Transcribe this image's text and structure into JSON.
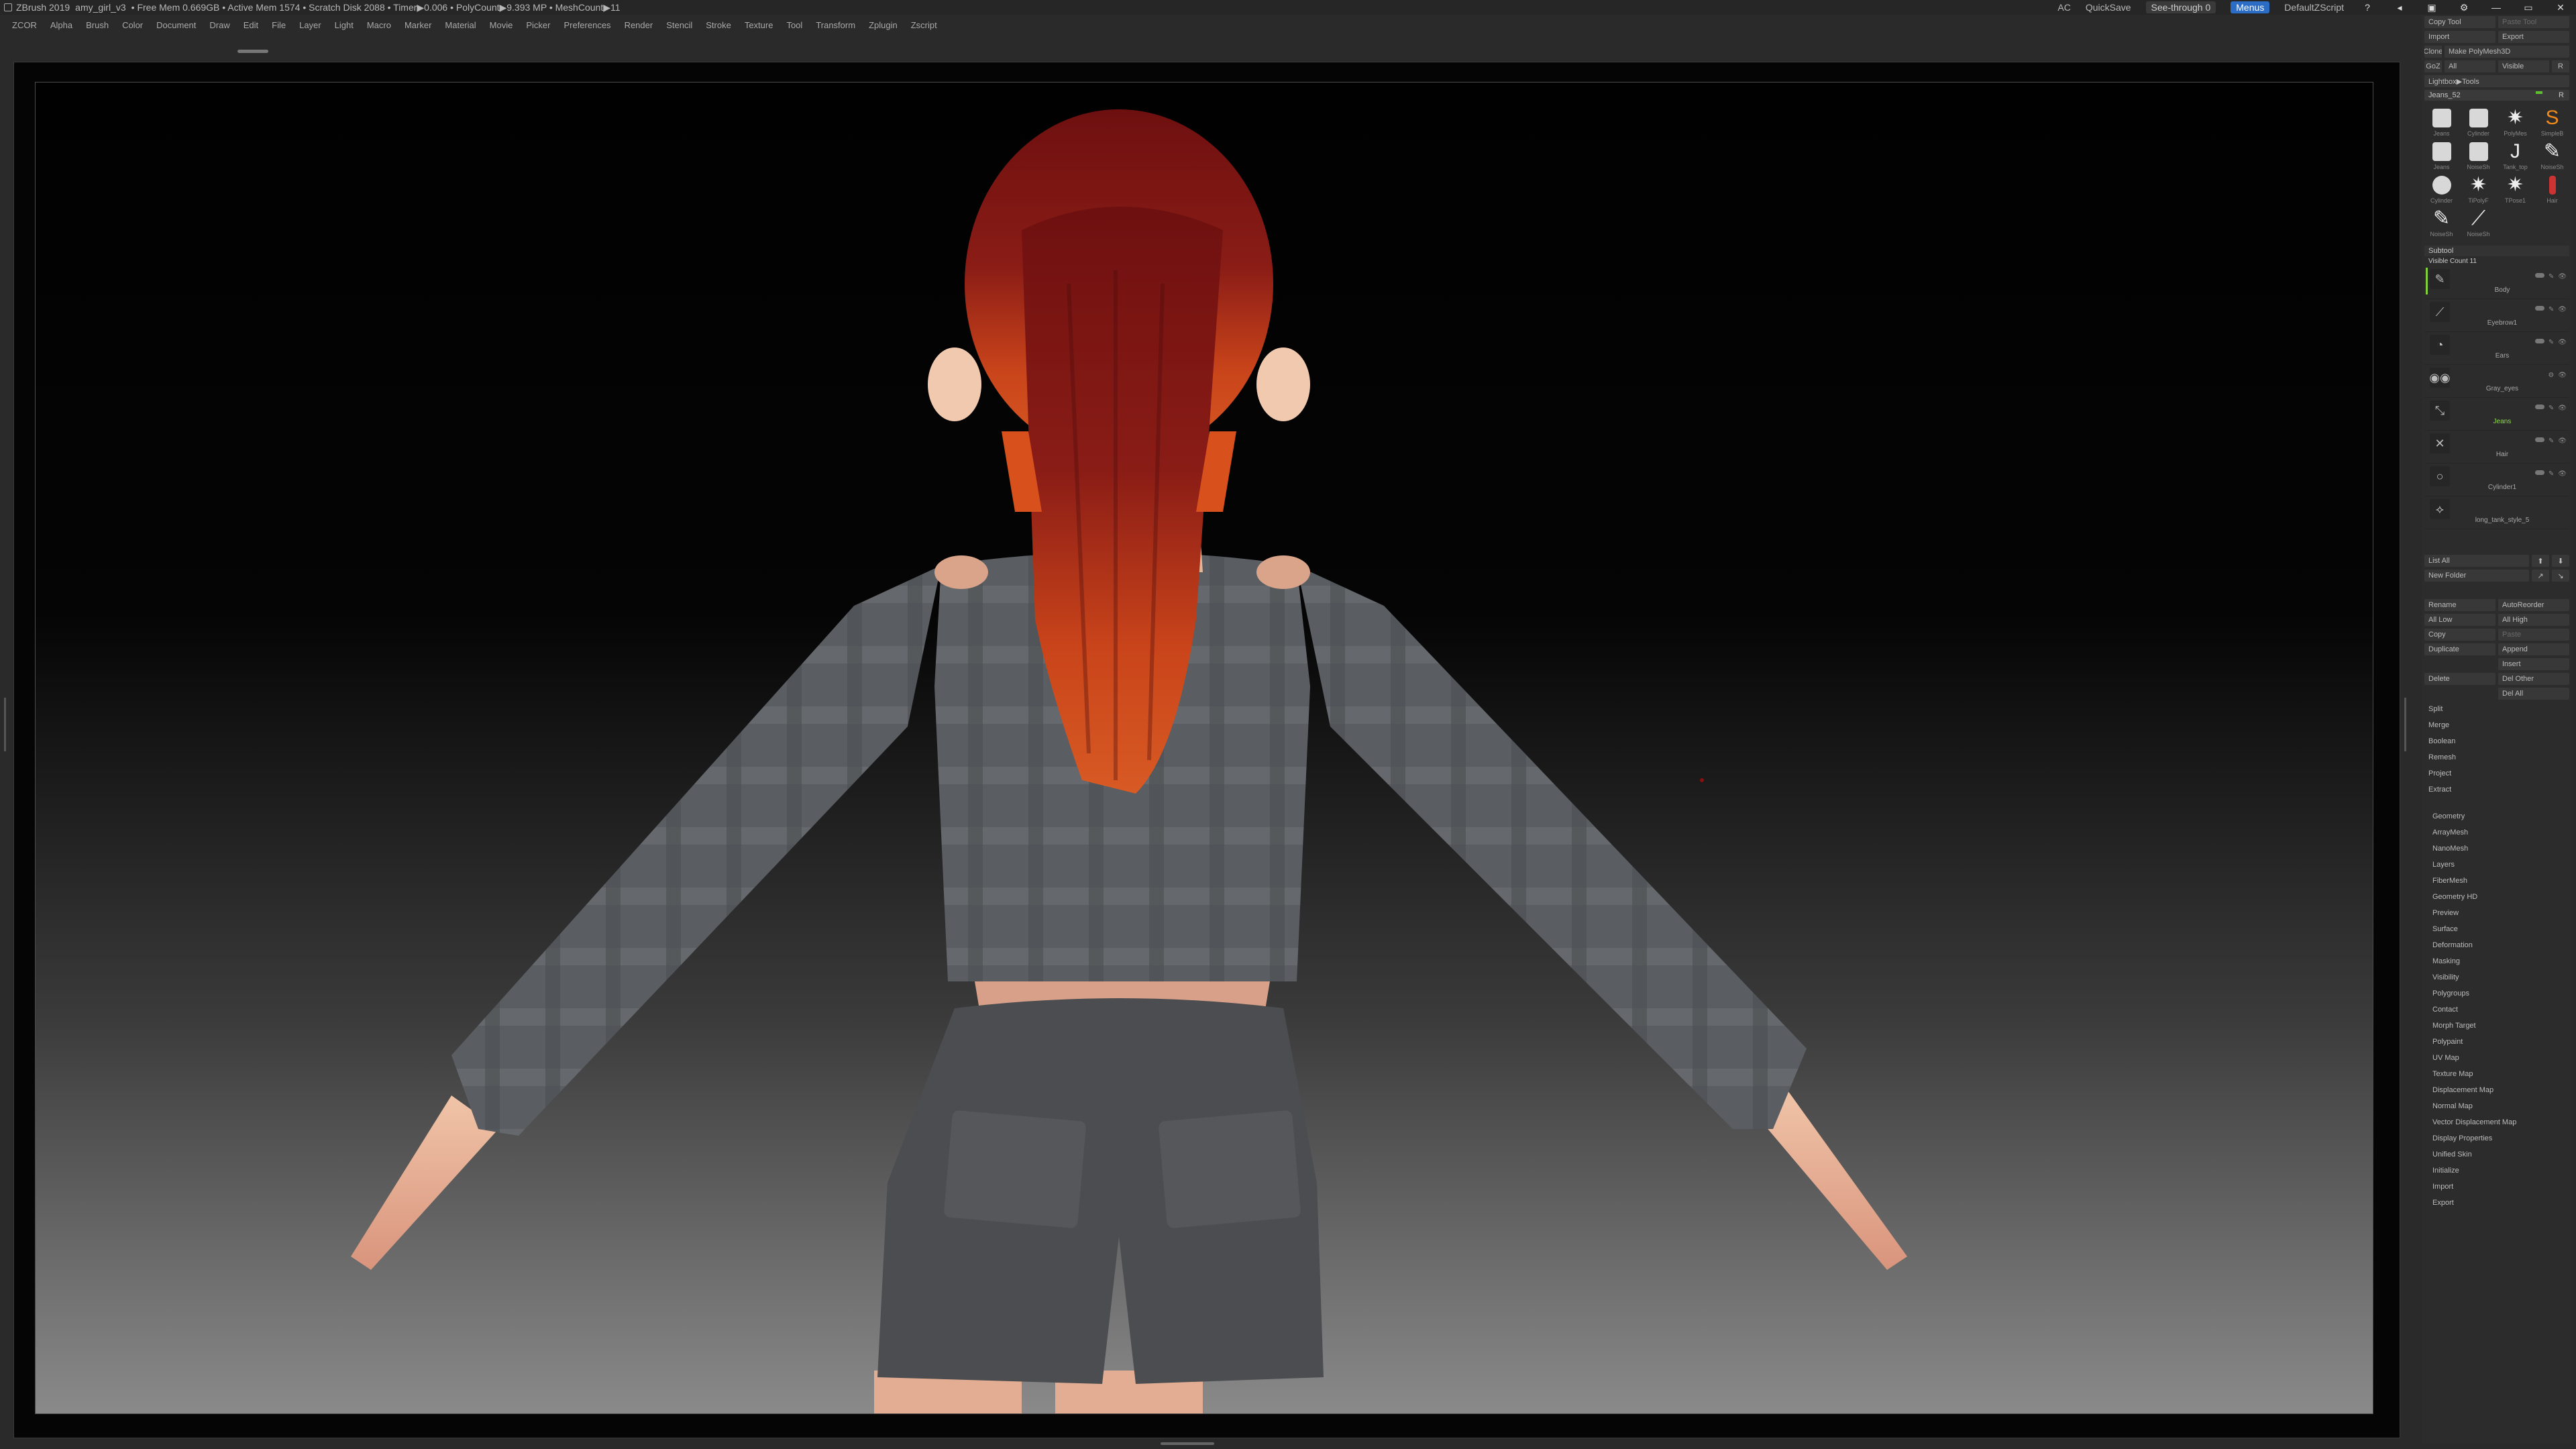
{
  "titlebar": {
    "app": "ZBrush 2019",
    "file": "amy_girl_v3",
    "stats": "• Free Mem 0.669GB • Active Mem 1574 • Scratch Disk 2088 • Timer▶0.006 • PolyCount▶9.393 MP • MeshCount▶11",
    "ac": "AC",
    "quicksave": "QuickSave",
    "seethrough": "See-through  0",
    "menus_label": "Menus",
    "script": "DefaultZScript",
    "win_icons": [
      "?",
      "◂",
      "▣",
      "⚙",
      "—",
      "▭",
      "✕"
    ]
  },
  "menubar": {
    "items": [
      "ZCOR",
      "Alpha",
      "Brush",
      "Color",
      "Document",
      "Draw",
      "Edit",
      "File",
      "Layer",
      "Light",
      "Macro",
      "Marker",
      "Material",
      "Movie",
      "Picker",
      "Preferences",
      "Render",
      "Stencil",
      "Stroke",
      "Texture",
      "Tool",
      "Transform",
      "Zplugin",
      "Zscript"
    ]
  },
  "tool": {
    "copy_tool": "Copy Tool",
    "paste_tool": "Paste Tool",
    "import": "Import",
    "export": "Export",
    "clone": "Clone",
    "make_polymesh": "Make PolyMesh3D",
    "goz": "GoZ",
    "all": "All",
    "visible": "Visible",
    "r": "R",
    "lightbox_tools": "Lightbox▶Tools",
    "current_tool": "Jeans_52",
    "current_value": "R",
    "thumbs": [
      {
        "label": "Jeans",
        "shape": "sq",
        "icon": ""
      },
      {
        "label": "Cylinder",
        "shape": "sq",
        "icon": ""
      },
      {
        "label": "PolyMes",
        "shape": "star",
        "icon": "✷"
      },
      {
        "label": "SimpleB",
        "shape": "orange",
        "icon": "S"
      },
      {
        "label": "Jeans",
        "shape": "sq",
        "icon": ""
      },
      {
        "label": "NoiseSh",
        "shape": "sq",
        "icon": ""
      },
      {
        "label": "Tank_top",
        "shape": "star",
        "icon": "J"
      },
      {
        "label": "NoiseSh",
        "shape": "star",
        "icon": "✎"
      },
      {
        "label": "Cylinder",
        "shape": "",
        "icon": ""
      },
      {
        "label": "TiPolyF",
        "shape": "star",
        "icon": "✷"
      },
      {
        "label": "TPose1",
        "shape": "star",
        "icon": "✷"
      },
      {
        "label": "Hair",
        "shape": "red",
        "icon": ""
      },
      {
        "label": "NoiseSh",
        "shape": "star",
        "icon": "✎"
      },
      {
        "label": "NoiseSh",
        "shape": "star",
        "icon": "⟋"
      }
    ]
  },
  "subtool": {
    "title": "Subtool",
    "visible_count": "Visible Count 11",
    "items": [
      {
        "name": "Body",
        "icon": "✎"
      },
      {
        "name": "Eyebrow1",
        "icon": "⟋"
      },
      {
        "name": "Ears",
        "icon": "◔"
      },
      {
        "name": "Gray_eyes",
        "icon": "◉◉"
      },
      {
        "name": "Jeans",
        "icon": "⤡"
      },
      {
        "name": "Hair",
        "icon": "✕"
      },
      {
        "name": "Cylinder1",
        "icon": "○"
      },
      {
        "name": "long_tank_style_5",
        "icon": "⟡"
      }
    ]
  },
  "subtool_ops": {
    "list_all": "List All",
    "new_folder": "New Folder",
    "rename": "Rename",
    "autoreorder": "AutoReorder",
    "all_low": "All Low",
    "all_high": "All High",
    "copy": "Copy",
    "paste": "Paste",
    "duplicate": "Duplicate",
    "append": "Append",
    "insert": "Insert",
    "delete": "Delete",
    "del_other": "Del Other",
    "del_all": "Del All",
    "split": "Split",
    "merge": "Merge",
    "boolean": "Boolean",
    "remesh": "Remesh",
    "project": "Project",
    "extract": "Extract"
  },
  "tool_menu": {
    "items": [
      "Geometry",
      "ArrayMesh",
      "NanoMesh",
      "Layers",
      "FiberMesh",
      "Geometry HD",
      "Preview",
      "Surface",
      "Deformation",
      "Masking",
      "Visibility",
      "Polygroups",
      "Contact",
      "Morph Target",
      "Polypaint",
      "UV Map",
      "Texture Map",
      "Displacement Map",
      "Normal Map",
      "Vector Displacement Map",
      "Display Properties",
      "Unified Skin",
      "Initialize",
      "Import",
      "Export"
    ]
  },
  "colors": {
    "accent_green": "#7fd03a",
    "menus_blue": "#2b6cc4",
    "hair_dark": "#7a1414",
    "hair_light": "#e0561c",
    "shirt": "#5b5e62",
    "shorts": "#4c4e51",
    "skin": "#e9b69a"
  }
}
